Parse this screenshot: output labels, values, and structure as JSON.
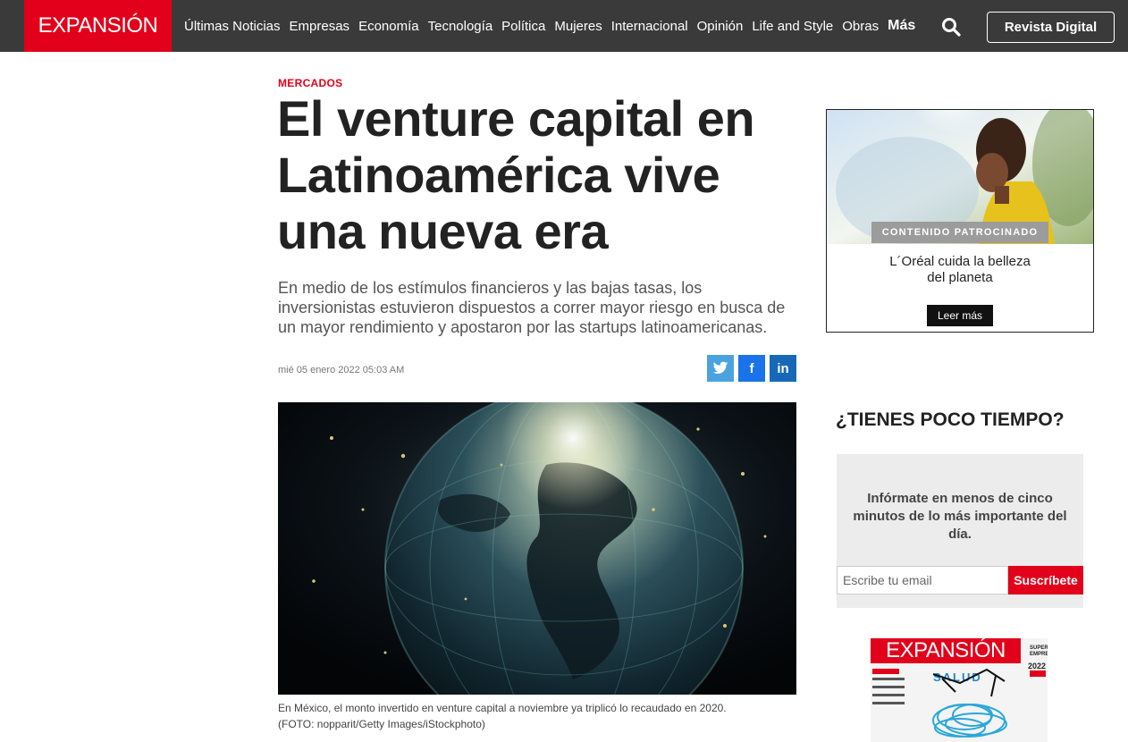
{
  "nav": {
    "logo": "EXPANSIÓN",
    "items": [
      "Últimas Noticias",
      "Empresas",
      "Economía",
      "Tecnología",
      "Política",
      "Mujeres",
      "Internacional",
      "Opinión",
      "Life and Style",
      "Obras"
    ],
    "more": "Más",
    "revista": "Revista Digital"
  },
  "article": {
    "section": "MERCADOS",
    "headline": "El venture capital en Latinoamérica vive una nueva era",
    "dek": "En medio de los estímulos financieros y las bajas tasas, los inversionistas estuvieron dispuestos a correr mayor riesgo en busca de un mayor rendimiento y apostaron por las startups latinoamericanas.",
    "date": "mié 05 enero 2022 05:03 AM",
    "caption_line1": "En México, el monto invertido en venture capital a noviembre ya triplicó lo recaudado en 2020.",
    "caption_line2": "(FOTO: nopparit/Getty Images/iStockphoto)"
  },
  "share": {
    "twitter": "twitter-icon",
    "facebook": "f",
    "linkedin": "in"
  },
  "ad": {
    "badge": "CONTENIDO PATROCINADO",
    "title_line1": "L´Oréal cuida la belleza",
    "title_line2": "del planeta",
    "button": "Leer más"
  },
  "newsletter": {
    "heading": "¿TIENES POCO TIEMPO?",
    "text": "Infórmate en menos de cinco minutos de lo más importante del día.",
    "placeholder": "Escribe tu email",
    "button": "Suscríbete"
  },
  "magazine": {
    "logo": "EXPANSIÓN",
    "title": "SALUD",
    "side": "SUPER EMPRESAS",
    "year": "2022"
  },
  "colors": {
    "brand_red": "#e2001a",
    "nav_bg": "#3a3a3a"
  }
}
